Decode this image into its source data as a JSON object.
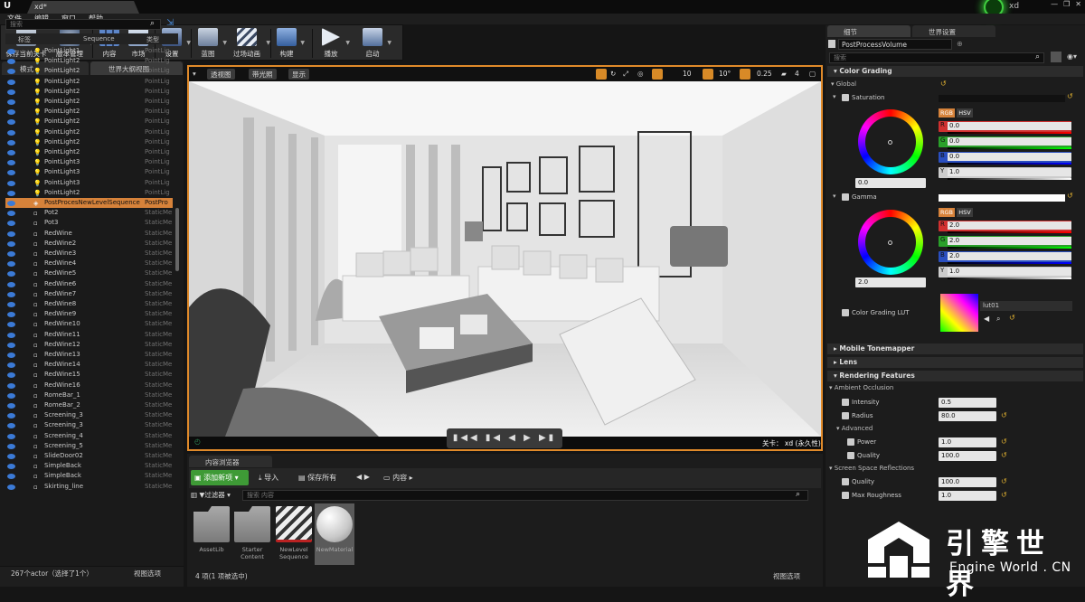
{
  "window": {
    "tab_title": "xd*",
    "user_name": "xd",
    "controls": [
      "—",
      "❐",
      "✕"
    ]
  },
  "menu": [
    "文件",
    "编辑",
    "窗口",
    "帮助"
  ],
  "toolbar": [
    {
      "label": "保存当前关卡",
      "icon": "save-icon"
    },
    {
      "label": "版本管理",
      "icon": "source-control-icon"
    },
    {
      "label": "内容",
      "icon": "content-icon"
    },
    {
      "label": "市场",
      "icon": "marketplace-icon"
    },
    {
      "label": "设置",
      "icon": "settings-icon"
    },
    {
      "label": "蓝图",
      "icon": "blueprint-icon"
    },
    {
      "label": "过场动画",
      "icon": "cinematics-icon"
    },
    {
      "label": "构建",
      "icon": "build-icon"
    },
    {
      "label": "播放",
      "icon": "play-icon"
    },
    {
      "label": "启动",
      "icon": "launch-icon"
    }
  ],
  "left_panel": {
    "tabs": [
      "模式",
      "世界大纲视图"
    ],
    "search_placeholder": "搜索",
    "columns": {
      "label": "标签",
      "sequence": "Sequence",
      "type": "类型"
    },
    "rows": [
      {
        "name": "PointLight1",
        "type": "PointLig",
        "kind": "light"
      },
      {
        "name": "PointLight2",
        "type": "PointLig",
        "kind": "light"
      },
      {
        "name": "PointLight2",
        "type": "PointLig",
        "kind": "light"
      },
      {
        "name": "PointLight2",
        "type": "PointLig",
        "kind": "light"
      },
      {
        "name": "PointLight2",
        "type": "PointLig",
        "kind": "light"
      },
      {
        "name": "PointLight2",
        "type": "PointLig",
        "kind": "light"
      },
      {
        "name": "PointLight2",
        "type": "PointLig",
        "kind": "light"
      },
      {
        "name": "PointLight2",
        "type": "PointLig",
        "kind": "light"
      },
      {
        "name": "PointLight2",
        "type": "PointLig",
        "kind": "light"
      },
      {
        "name": "PointLight2",
        "type": "PointLig",
        "kind": "light"
      },
      {
        "name": "PointLight2",
        "type": "PointLig",
        "kind": "light"
      },
      {
        "name": "PointLight3",
        "type": "PointLig",
        "kind": "light"
      },
      {
        "name": "PointLight3",
        "type": "PointLig",
        "kind": "light"
      },
      {
        "name": "PointLight3",
        "type": "PointLig",
        "kind": "light"
      },
      {
        "name": "PointLight2",
        "type": "PointLig",
        "kind": "light"
      },
      {
        "name": "PostProcesNewLevelSequence",
        "type": "PostPro",
        "kind": "pp",
        "selected": true
      },
      {
        "name": "Pot2",
        "type": "StaticMe",
        "kind": "mesh"
      },
      {
        "name": "Pot3",
        "type": "StaticMe",
        "kind": "mesh"
      },
      {
        "name": "RedWine",
        "type": "StaticMe",
        "kind": "mesh"
      },
      {
        "name": "RedWine2",
        "type": "StaticMe",
        "kind": "mesh"
      },
      {
        "name": "RedWine3",
        "type": "StaticMe",
        "kind": "mesh"
      },
      {
        "name": "RedWine4",
        "type": "StaticMe",
        "kind": "mesh"
      },
      {
        "name": "RedWine5",
        "type": "StaticMe",
        "kind": "mesh"
      },
      {
        "name": "RedWine6",
        "type": "StaticMe",
        "kind": "mesh"
      },
      {
        "name": "RedWine7",
        "type": "StaticMe",
        "kind": "mesh"
      },
      {
        "name": "RedWine8",
        "type": "StaticMe",
        "kind": "mesh"
      },
      {
        "name": "RedWine9",
        "type": "StaticMe",
        "kind": "mesh"
      },
      {
        "name": "RedWine10",
        "type": "StaticMe",
        "kind": "mesh"
      },
      {
        "name": "RedWine11",
        "type": "StaticMe",
        "kind": "mesh"
      },
      {
        "name": "RedWine12",
        "type": "StaticMe",
        "kind": "mesh"
      },
      {
        "name": "RedWine13",
        "type": "StaticMe",
        "kind": "mesh"
      },
      {
        "name": "RedWine14",
        "type": "StaticMe",
        "kind": "mesh"
      },
      {
        "name": "RedWine15",
        "type": "StaticMe",
        "kind": "mesh"
      },
      {
        "name": "RedWine16",
        "type": "StaticMe",
        "kind": "mesh"
      },
      {
        "name": "RomeBar_1",
        "type": "StaticMe",
        "kind": "mesh"
      },
      {
        "name": "RomeBar_2",
        "type": "StaticMe",
        "kind": "mesh"
      },
      {
        "name": "Screening_3",
        "type": "StaticMe",
        "kind": "mesh"
      },
      {
        "name": "Screening_3",
        "type": "StaticMe",
        "kind": "mesh"
      },
      {
        "name": "Screening_4",
        "type": "StaticMe",
        "kind": "mesh"
      },
      {
        "name": "Screening_5",
        "type": "StaticMe",
        "kind": "mesh"
      },
      {
        "name": "SlideDoor02",
        "type": "StaticMe",
        "kind": "mesh"
      },
      {
        "name": "SimpleBack",
        "type": "StaticMe",
        "kind": "mesh"
      },
      {
        "name": "SimpleBack",
        "type": "StaticMe",
        "kind": "mesh"
      },
      {
        "name": "Skirting_line",
        "type": "StaticMe",
        "kind": "mesh"
      }
    ],
    "footer_count": "267个actor（选择了1个）",
    "footer_view": "视图选项"
  },
  "viewport": {
    "perspective": "透视图",
    "lit": "带光照",
    "show": "显示",
    "grid_snap": "10",
    "rot_snap": "10°",
    "scale_snap": "0.25",
    "cam_speed": "4",
    "level_label": "关卡：",
    "level_name": "xd (永久性)",
    "playback": "▮◀◀ ▮◀ ◀ ▶ ▶▮ ▶▶▮ ⟶"
  },
  "content_browser": {
    "tab": "内容浏览器",
    "add_new": "添加新项",
    "import": "导入",
    "save_all": "保存所有",
    "path": "内容",
    "filters": "过滤器",
    "search_placeholder": "搜索 内容",
    "assets": [
      {
        "label": "AssetLib",
        "kind": "folder"
      },
      {
        "label": "Starter Content",
        "kind": "folder"
      },
      {
        "label": "NewLevel Sequence",
        "kind": "sequence"
      },
      {
        "label": "NewMaterial",
        "kind": "material"
      }
    ],
    "footer_count": "4 项(1 项被选中)",
    "footer_view": "视图选项"
  },
  "details": {
    "tabs": [
      "细节",
      "世界设置"
    ],
    "object_name": "PostProcessVolume",
    "search_placeholder": "搜索",
    "sections": {
      "color_grading": "Color Grading",
      "global": "Global",
      "mobile_tonemapper": "Mobile Tonemapper",
      "lens": "Lens",
      "rendering_features": "Rendering Features",
      "ambient_occlusion": "Ambient Occlusion",
      "advanced": "Advanced",
      "ssr": "Screen Space Reflections"
    },
    "saturation": {
      "label": "Saturation",
      "wheel_value": "0.0",
      "R": "0.0",
      "G": "0.0",
      "B": "0.0",
      "Y": "1.0"
    },
    "gamma": {
      "label": "Gamma",
      "wheel_value": "2.0",
      "R": "2.0",
      "G": "2.0",
      "B": "2.0",
      "Y": "1.0"
    },
    "rgb_label": "RGB",
    "hsv_label": "HSV",
    "lut_label": "Color Grading LUT",
    "lut_asset": "lut01",
    "ao": {
      "intensity_label": "Intensity",
      "intensity": "0.5",
      "radius_label": "Radius",
      "radius": "80.0",
      "power_label": "Power",
      "power": "1.0",
      "quality_label": "Quality",
      "quality": "100.0"
    },
    "ssr": {
      "quality_label": "Quality",
      "quality": "100.0",
      "roughness_label": "Max Roughness",
      "roughness": "1.0"
    }
  },
  "watermark": {
    "cn": "引擎世界",
    "en": "Engine World . CN"
  },
  "colors": {
    "accent_orange": "#d6823a",
    "add_green": "#3e9a36",
    "eye_blue": "#3b7ad6"
  }
}
